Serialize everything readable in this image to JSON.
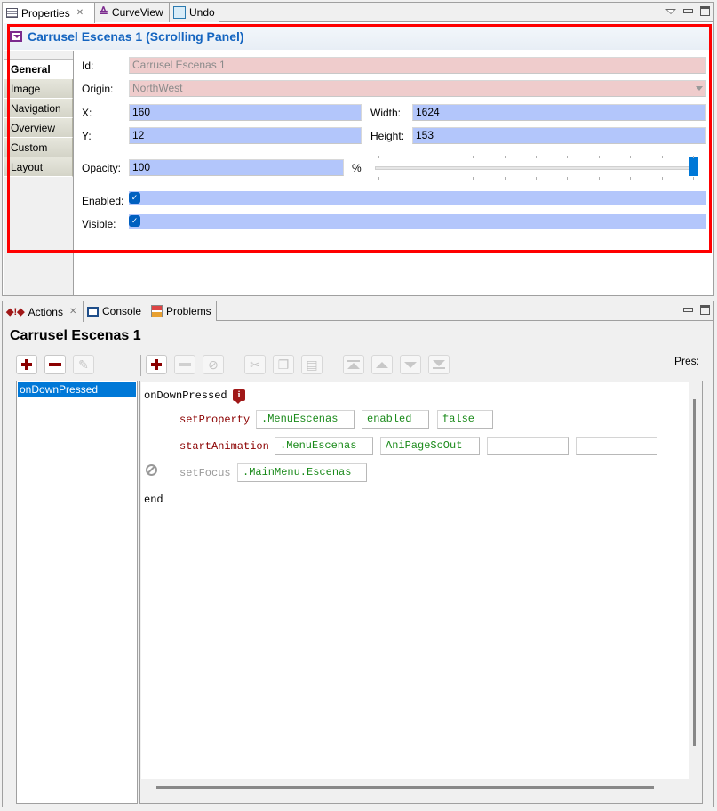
{
  "top_view": {
    "tabs": [
      {
        "label": "Properties",
        "icon": "properties-icon",
        "active": true,
        "closable": true
      },
      {
        "label": "CurveView",
        "icon": "curve-icon",
        "active": false
      },
      {
        "label": "Undo",
        "icon": "undo-icon",
        "active": false
      }
    ],
    "controls": [
      "view-menu-icon",
      "minimize-icon",
      "maximize-icon"
    ],
    "header_title": "Carrusel Escenas 1 (Scrolling Panel)",
    "side_tabs": [
      "General",
      "Image",
      "Navigation",
      "Overview",
      "Custom",
      "Layout"
    ],
    "active_side_tab": "General",
    "form": {
      "id_label": "Id:",
      "id_value": "Carrusel Escenas 1",
      "origin_label": "Origin:",
      "origin_value": "NorthWest",
      "x_label": "X:",
      "x_value": "160",
      "y_label": "Y:",
      "y_value": "12",
      "width_label": "Width:",
      "width_value": "1624",
      "height_label": "Height:",
      "height_value": "153",
      "opacity_label": "Opacity:",
      "opacity_value": "100",
      "opacity_unit": "%",
      "opacity_slider_percent": 100,
      "enabled_label": "Enabled:",
      "enabled_checked": true,
      "visible_label": "Visible:",
      "visible_checked": true
    },
    "highlight_color": "#ff0000"
  },
  "bottom_view": {
    "tabs": [
      {
        "label": "Actions",
        "icon": "actions-icon",
        "active": true,
        "closable": true
      },
      {
        "label": "Console",
        "icon": "console-icon",
        "active": false
      },
      {
        "label": "Problems",
        "icon": "problems-icon",
        "active": false
      }
    ],
    "title": "Carrusel Escenas 1",
    "pres_label": "Pres:",
    "events": [
      "onDownPressed"
    ],
    "selected_event": "onDownPressed",
    "code": {
      "event_name": "onDownPressed",
      "lines": [
        {
          "fn": "setProperty",
          "disabled": false,
          "args": [
            ".MenuEscenas",
            "enabled",
            "false"
          ]
        },
        {
          "fn": "startAnimation",
          "disabled": false,
          "args": [
            ".MenuEscenas",
            "AniPageScOut",
            "",
            ""
          ]
        },
        {
          "fn": "setFocus",
          "disabled": true,
          "args": [
            ".MainMenu.Escenas"
          ]
        }
      ],
      "end_keyword": "end"
    }
  },
  "colors": {
    "accent_blue": "#1565c0",
    "field_blue": "#b3c6fb",
    "readonly_pink": "#efcccc",
    "selection": "#0078d7",
    "function_red": "#8b0000",
    "arg_green": "#1a8a1a"
  }
}
